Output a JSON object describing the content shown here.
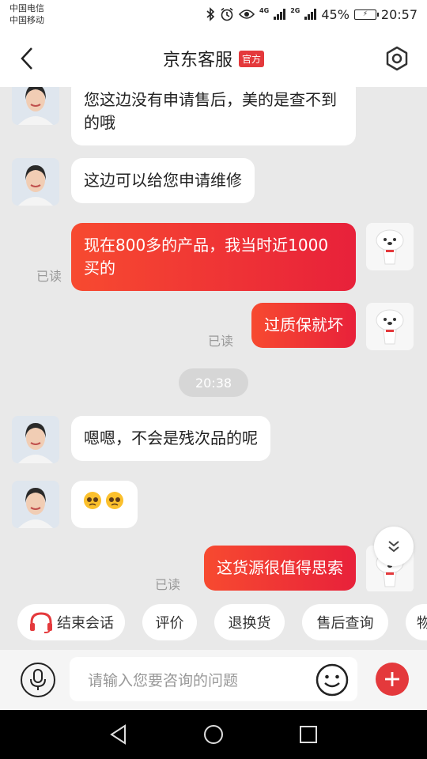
{
  "status_bar": {
    "carrier_1": "中国电信",
    "carrier_2": "中国移动",
    "net_1": "4G",
    "net_2": "2G",
    "battery": "45%",
    "time": "20:57"
  },
  "header": {
    "title": "京东客服",
    "badge": "官方"
  },
  "chat": {
    "messages": [
      {
        "from": "agent",
        "text": "您这边没有申请售后，美的是查不到的哦"
      },
      {
        "from": "agent",
        "text": "这边可以给您申请维修"
      },
      {
        "from": "user",
        "text": "现在800多的产品，我当时近1000买的",
        "status": "已读"
      },
      {
        "from": "user",
        "text": "过质保就坏",
        "status": "已读"
      },
      {
        "from": "agent",
        "text": "嗯嗯，不会是残次品的呢"
      },
      {
        "from": "agent",
        "emoji": "🥺🥺"
      },
      {
        "from": "user",
        "text": "这货源很值得思索",
        "status": "已读"
      }
    ],
    "time_separator": "20:38"
  },
  "quick_actions": {
    "end_chat": "结束会话",
    "review": "评价",
    "return_exchange": "退换货",
    "after_sales_query": "售后查询",
    "partial": "物"
  },
  "input_bar": {
    "placeholder": "请输入您要咨询的问题"
  },
  "icons": {
    "back": "back-arrow-icon",
    "settings": "hexagon-settings-icon",
    "scroll": "double-chevron-down-icon",
    "mic": "microphone-icon",
    "emoji": "smiley-icon",
    "plus": "plus-icon",
    "headset": "headset-icon"
  },
  "colors": {
    "accent": "#e4393c",
    "bubble_out_start": "#f74a30",
    "bubble_out_end": "#e8213a",
    "chat_bg": "#e9e9e9"
  }
}
